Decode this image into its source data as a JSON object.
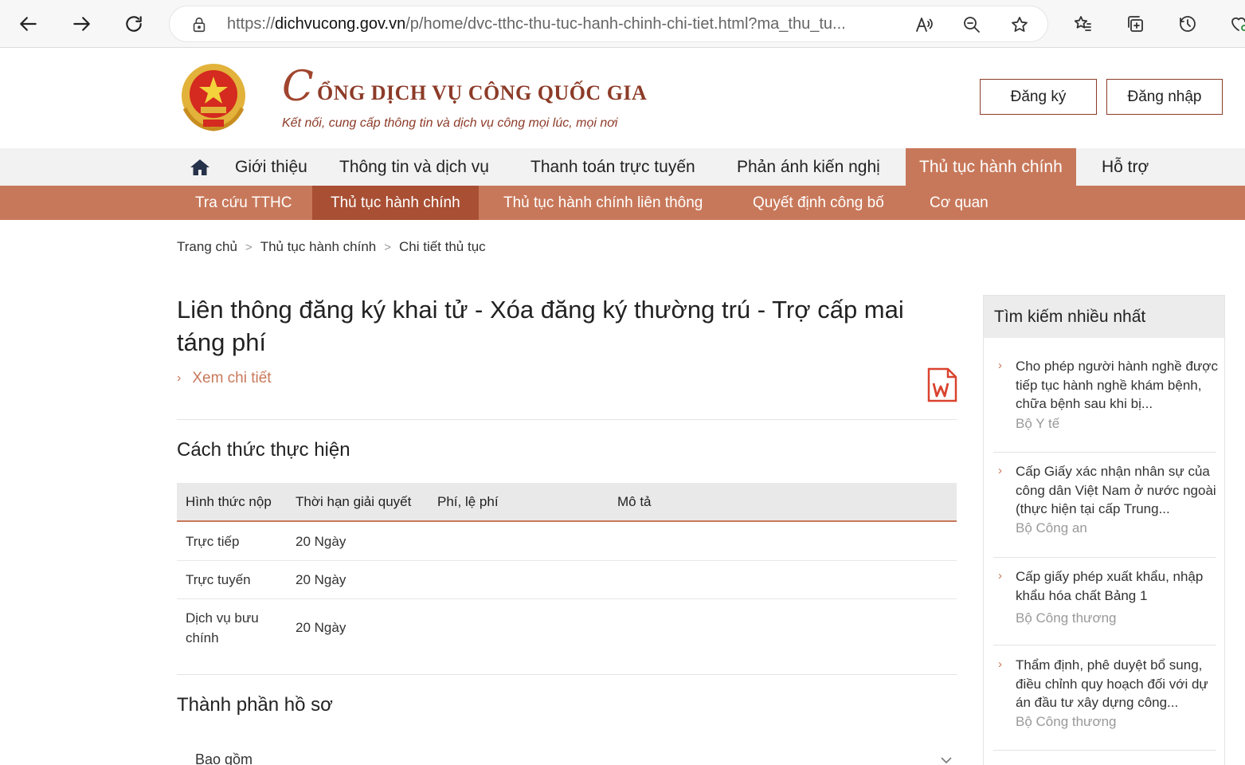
{
  "browser": {
    "url_prefix": "https://",
    "url_host": "dichvucong.gov.vn",
    "url_path": "/p/home/dvc-tthc-thu-tuc-hanh-chinh-chi-tiet.html?ma_thu_tu..."
  },
  "header": {
    "logo_initial": "C",
    "logo_rest": "ỔNG DỊCH VỤ CÔNG QUỐC GIA",
    "tagline": "Kết nối, cung cấp thông tin và dịch vụ công mọi lúc, mọi nơi",
    "register_label": "Đăng ký",
    "login_label": "Đăng nhập"
  },
  "main_nav": {
    "items": [
      {
        "label": "Giới thiệu"
      },
      {
        "label": "Thông tin và dịch vụ"
      },
      {
        "label": "Thanh toán trực tuyến"
      },
      {
        "label": "Phản ánh kiến nghị"
      },
      {
        "label": "Thủ tục hành chính"
      },
      {
        "label": "Hỗ trợ"
      }
    ]
  },
  "sub_nav": {
    "items": [
      {
        "label": "Tra cứu TTHC"
      },
      {
        "label": "Thủ tục hành chính"
      },
      {
        "label": "Thủ tục hành chính liên thông"
      },
      {
        "label": "Quyết định công bố"
      },
      {
        "label": "Cơ quan"
      }
    ]
  },
  "breadcrumb": {
    "items": [
      "Trang chủ",
      "Thủ tục hành chính",
      "Chi tiết thủ tục"
    ],
    "separator": ">"
  },
  "content": {
    "title": "Liên thông đăng ký khai tử - Xóa đăng ký thường trú - Trợ cấp mai táng phí",
    "detail_link": "Xem chi tiết",
    "section_method": "Cách thức thực hiện",
    "section_docs": "Thành phần hồ sơ",
    "accordion_label": "Bao gồm",
    "table": {
      "headers": [
        "Hình thức nộp",
        "Thời hạn giải quyết",
        "Phí, lệ phí",
        "Mô tả"
      ],
      "rows": [
        {
          "method": "Trực tiếp",
          "duration": "20 Ngày"
        },
        {
          "method": "Trực tuyến",
          "duration": "20 Ngày"
        },
        {
          "method": "Dịch vụ bưu chính",
          "duration": "20 Ngày"
        }
      ]
    }
  },
  "sidebar": {
    "title": "Tìm kiếm nhiều nhất",
    "items": [
      {
        "title": "Cho phép người hành nghề được tiếp tục hành nghề khám bệnh, chữa bệnh sau khi bị...",
        "org": "Bộ Y tế"
      },
      {
        "title": "Cấp Giấy xác nhận nhân sự của công dân Việt Nam ở nước ngoài (thực hiện tại cấp Trung...",
        "org": "Bộ Công an"
      },
      {
        "title": "Cấp giấy phép xuất khẩu, nhập khẩu hóa chất Bảng 1",
        "org": "Bộ Công thương"
      },
      {
        "title": "Thẩm định, phê duyệt bổ sung, điều chỉnh quy hoạch đối với dự án đầu tư xây dựng công...",
        "org": "Bộ Công thương"
      }
    ]
  },
  "colors": {
    "accent": "#c8785a",
    "accent_dark": "#a94f33",
    "brand": "#8c3b28"
  }
}
